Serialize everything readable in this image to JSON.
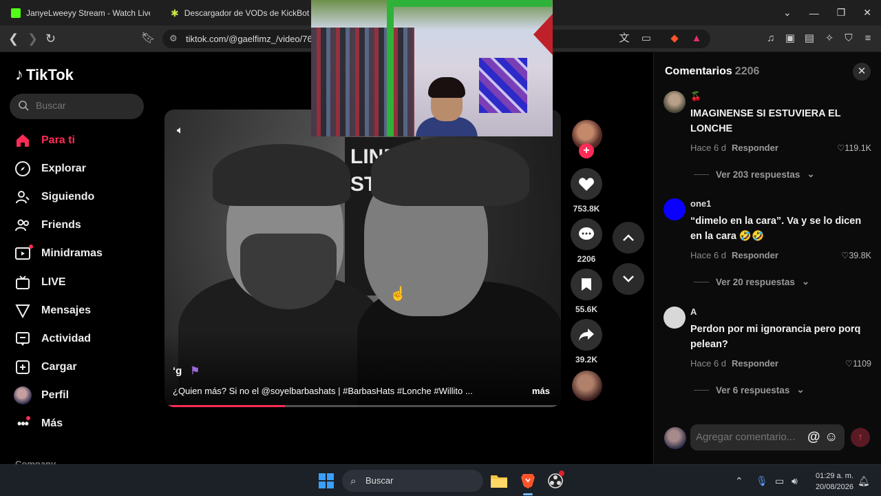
{
  "browser": {
    "tabs": [
      {
        "title": "JanyeLweeyy Stream - Watch Live on",
        "color": "#53fc18"
      },
      {
        "title": "Descargador de VODs de KickBot",
        "color": "#c8e64a"
      }
    ],
    "url": "tiktok.com/@gaelfimz_/video/76"
  },
  "tiktok": {
    "logo_text": "TikTok",
    "search_placeholder": "Buscar",
    "nav": [
      {
        "label": "Para ti",
        "icon": "home-icon",
        "active": true
      },
      {
        "label": "Explorar",
        "icon": "compass-icon"
      },
      {
        "label": "Siguiendo",
        "icon": "following-icon"
      },
      {
        "label": "Friends",
        "icon": "friends-icon"
      },
      {
        "label": "Minidramas",
        "icon": "film-icon"
      },
      {
        "label": "LIVE",
        "icon": "live-icon"
      },
      {
        "label": "Mensajes",
        "icon": "send-icon"
      },
      {
        "label": "Actividad",
        "icon": "inbox-icon"
      },
      {
        "label": "Cargar",
        "icon": "upload-icon"
      },
      {
        "label": "Perfil",
        "icon": "avatar"
      },
      {
        "label": "Más",
        "icon": "more-icon"
      }
    ],
    "company_label": "Company",
    "accent": "#fe2c55"
  },
  "video": {
    "author": "‘g",
    "caption": "¿Quien más? Si no el @soyelbarbashats | #BarbasHats #Lonche #Willito ...",
    "more_label": "más",
    "progress": 0.3,
    "sign_lines": [
      "LINE",
      "STA"
    ],
    "likes": "753.8K",
    "comments": "2206",
    "saves": "55.6K",
    "shares": "39.2K"
  },
  "comments": {
    "title": "Comentarios",
    "count": "2206",
    "items": [
      {
        "user": "🍒",
        "text": "IMAGINENSE SI ESTUVIERA EL LONCHE",
        "time": "Hace 6 d",
        "reply": "Responder",
        "likes": "119.1K",
        "more": "Ver 203 respuestas",
        "avatar_color": "#6a6a5a"
      },
      {
        "user": "one1",
        "text": "“dimelo en la cara”. Va y se lo dicen en la cara 🤣🤣",
        "time": "Hace 6 d",
        "reply": "Responder",
        "likes": "39.8K",
        "more": "Ver 20 respuestas",
        "avatar_color": "#0a00ff"
      },
      {
        "user": "A",
        "text": "Perdon por mi ignorancia pero porq pelean?",
        "time": "Hace 6 d",
        "reply": "Responder",
        "likes": "1109",
        "more": "Ver 6 respuestas",
        "avatar_color": "#d8d8d8"
      }
    ],
    "input_placeholder": "Agregar comentario..."
  },
  "taskbar": {
    "search_label": "Buscar",
    "time": "01:29 a. m.",
    "date": "20/08/2026"
  }
}
